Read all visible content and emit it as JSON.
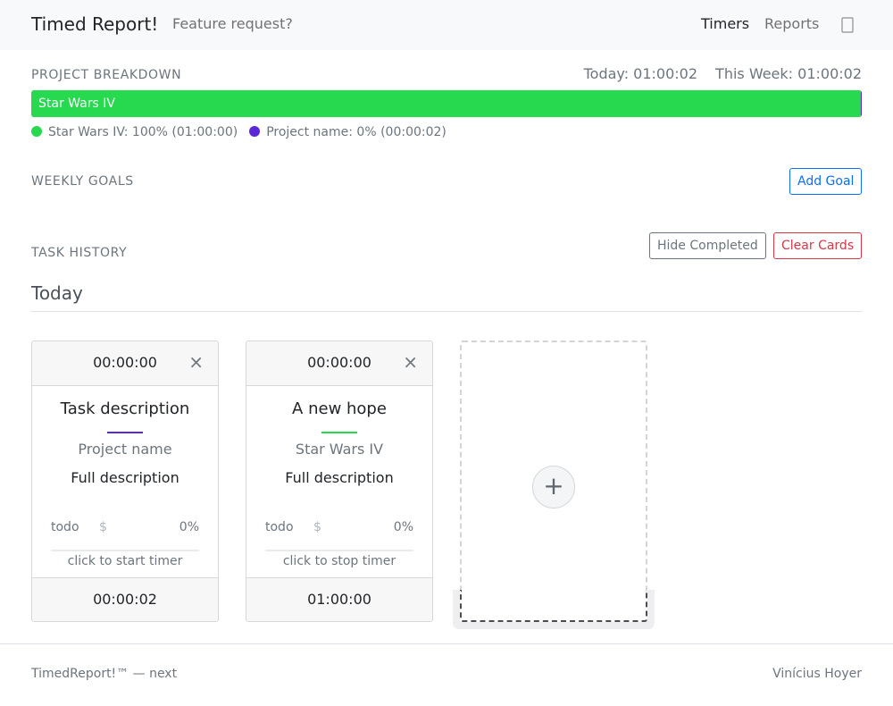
{
  "navbar": {
    "brand": "Timed Report!",
    "feature_link": "Feature request?",
    "nav_timers": "Timers",
    "nav_reports": "Reports",
    "nav_icon": "user-icon"
  },
  "breakdown": {
    "label": "PROJECT BREAKDOWN",
    "today": "Today: 01:00:02",
    "this_week": "This Week: 01:00:02",
    "segments": [
      {
        "label": "Star Wars IV",
        "fraction": 0.9994,
        "color": "#26d94e"
      },
      {
        "label": "",
        "fraction": 0.0006,
        "color": "#5b2ad6"
      }
    ],
    "legend": [
      {
        "text": "Star Wars IV: 100% (01:00:00)",
        "color": "#26d94e"
      },
      {
        "text": "Project name: 0% (00:00:02)",
        "color": "#5b2ad6"
      }
    ]
  },
  "goals": {
    "label": "WEEKLY GOALS",
    "add_button": "Add Goal"
  },
  "history": {
    "label": "TASK HISTORY",
    "hide_button": "Hide Completed",
    "clear_button": "Clear Cards",
    "day_title": "Today"
  },
  "cards": [
    {
      "time": "00:00:00",
      "close": "×",
      "title": "Task description",
      "project": "Project name",
      "project_color": "#5b2ad6",
      "description": "Full description",
      "status": "todo",
      "dollar": "$",
      "percent": "0%",
      "progress": 0,
      "hint": "click to start timer",
      "total": "00:00:02"
    },
    {
      "time": "00:00:00",
      "close": "×",
      "title": "A new hope",
      "project": "Star Wars IV",
      "project_color": "#26d94e",
      "description": "Full description",
      "status": "todo",
      "dollar": "$",
      "percent": "0%",
      "progress": 0,
      "hint": "click to stop timer",
      "total": "01:00:00"
    }
  ],
  "add_card": {
    "symbol": "+",
    "icon": "plus-icon"
  },
  "footer": {
    "left": "TimedReport!™ — next",
    "right": "Vinícius Hoyer"
  }
}
